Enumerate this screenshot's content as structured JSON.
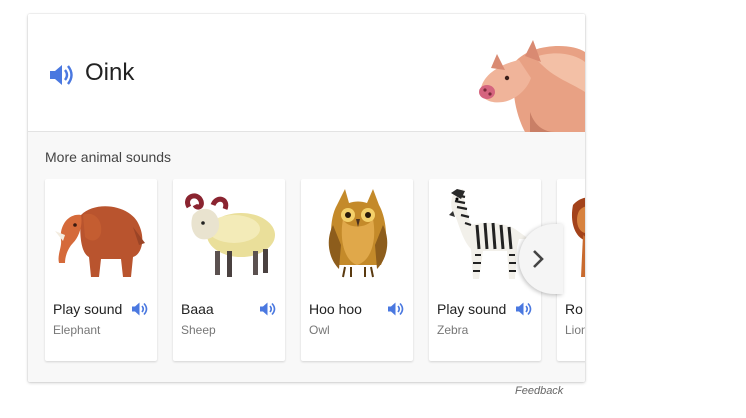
{
  "main_sound": {
    "label": "Oink",
    "icon": "speaker-icon",
    "accent": "#4a78e0"
  },
  "more_section": {
    "label": "More animal sounds"
  },
  "animals": [
    {
      "name": "Play sound",
      "species": "Elephant",
      "icon": "elephant-illustration"
    },
    {
      "name": "Baaa",
      "species": "Sheep",
      "icon": "sheep-illustration"
    },
    {
      "name": "Hoo hoo",
      "species": "Owl",
      "icon": "owl-illustration"
    },
    {
      "name": "Play sound",
      "species": "Zebra",
      "icon": "zebra-illustration"
    },
    {
      "name": "Ro",
      "species": "Lion",
      "icon": "lion-illustration"
    }
  ],
  "next_icon": "chevron-right-icon",
  "feedback": {
    "label": "Feedback"
  }
}
